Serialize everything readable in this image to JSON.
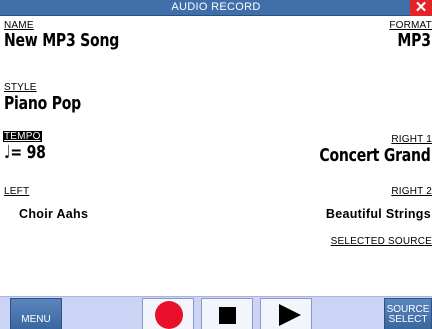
{
  "window": {
    "title": "AUDIO RECORD",
    "close_glyph": "✕"
  },
  "fields": {
    "name_label": "NAME",
    "name_value": "New MP3 Song",
    "format_label": "FORMAT",
    "format_value": "MP3",
    "style_label": "STYLE",
    "style_value": "Piano Pop",
    "tempo_label": "TEMPO",
    "tempo_value": "♩= 98",
    "right1_label": "RIGHT 1",
    "right1_value": "Concert Grand",
    "left_label": "LEFT",
    "left_value": "Choir Aahs",
    "right2_label": "RIGHT 2",
    "right2_value": "Beautiful Strings",
    "selected_source_label": "SELECTED SOURCE"
  },
  "bottom_bar": {
    "menu_label": "MENU",
    "source_label_1": "SOURCE",
    "source_label_2": "SELECT",
    "record_icon": "record-icon",
    "stop_icon": "stop-icon",
    "play_icon": "play-icon"
  },
  "colors": {
    "titlebar": "#3f6ea8",
    "close": "#e3222a",
    "record": "#e8102a",
    "bottom_bar": "#cbd4f4"
  }
}
